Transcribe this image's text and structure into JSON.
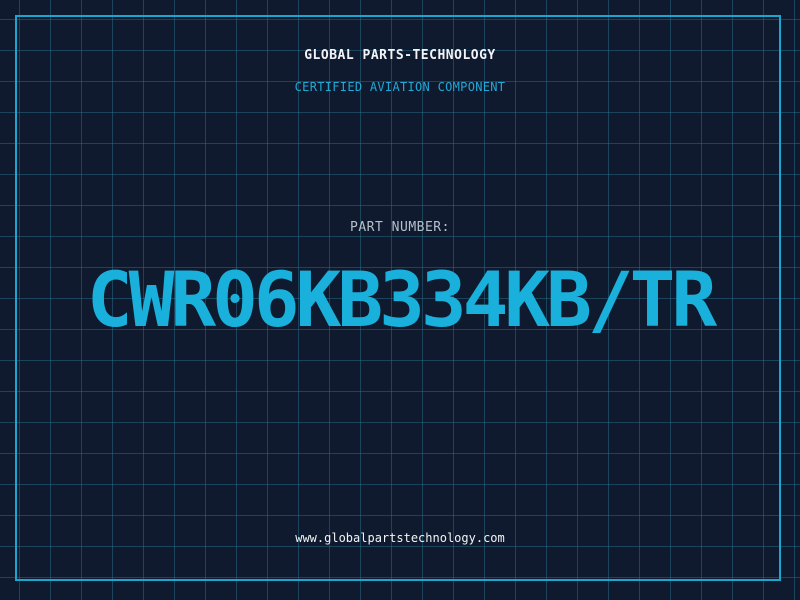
{
  "header": {
    "company": "GLOBAL PARTS-TECHNOLOGY",
    "tagline": "CERTIFIED AVIATION COMPONENT"
  },
  "part": {
    "label": "PART NUMBER:",
    "number": "CWR06KB334KB/TR"
  },
  "footer": {
    "website": "www.globalpartstechnology.com"
  },
  "colors": {
    "background": "#101a2e",
    "grid": "#287896",
    "accent": "#19b0dc",
    "text": "#f2f4f7",
    "muted": "#b5c0cc"
  }
}
